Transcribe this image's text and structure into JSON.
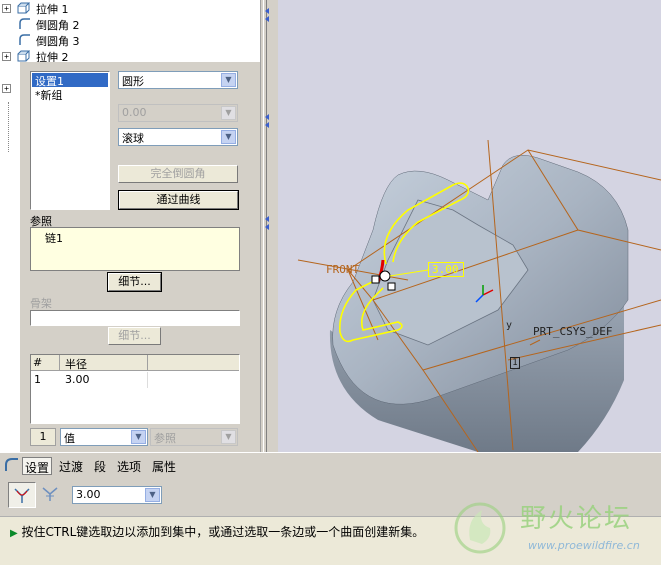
{
  "model_tree": {
    "items": [
      {
        "label": "拉伸 1",
        "expandable": true
      },
      {
        "label": "倒圆角 2",
        "expandable": false
      },
      {
        "label": "倒圆角 3",
        "expandable": false
      },
      {
        "label": "拉伸 2",
        "expandable": true
      }
    ]
  },
  "sets_panel": {
    "sets": [
      {
        "label": "设置1",
        "selected": true
      },
      {
        "label": "*新组",
        "selected": false
      }
    ],
    "shape_select": "圆形",
    "value_select": "0.00",
    "method_select": "滚球",
    "full_round_button": "完全倒圆角",
    "through_curve_button": "通过曲线",
    "references_label": "参照",
    "references": [
      "链1"
    ],
    "details_button": "细节...",
    "skeleton_label": "骨架",
    "skeleton_details_button": "细节...",
    "table": {
      "headers": [
        "#",
        "半径"
      ],
      "rows": [
        [
          "1",
          "3.00"
        ]
      ]
    },
    "footer_index": "1",
    "footer_value_select": "值",
    "footer_ref_select": "参照"
  },
  "viewport": {
    "labels": {
      "front": "FRONT",
      "dimension": "3.00",
      "csys": "PRT_CSYS_DEF",
      "y_axis": "y",
      "axis_marker": "1"
    },
    "colors": {
      "background": "#d4d4e2",
      "part": "#a9b4c2",
      "datum": "#b5651d",
      "highlight": "#ffff00",
      "selection": "#e00000"
    }
  },
  "dashboard": {
    "tabs": [
      {
        "label": "设置",
        "active": true
      },
      {
        "label": "过渡",
        "active": false
      },
      {
        "label": "段",
        "active": false
      },
      {
        "label": "选项",
        "active": false
      },
      {
        "label": "属性",
        "active": false
      }
    ],
    "radius_value": "3.00"
  },
  "status_bar": {
    "message": "按住CTRL键选取边以添加到集中，或通过选取一条边或一个曲面创建新集。"
  },
  "watermark": {
    "title": "野火论坛",
    "url": "www.proewildfire.cn"
  }
}
